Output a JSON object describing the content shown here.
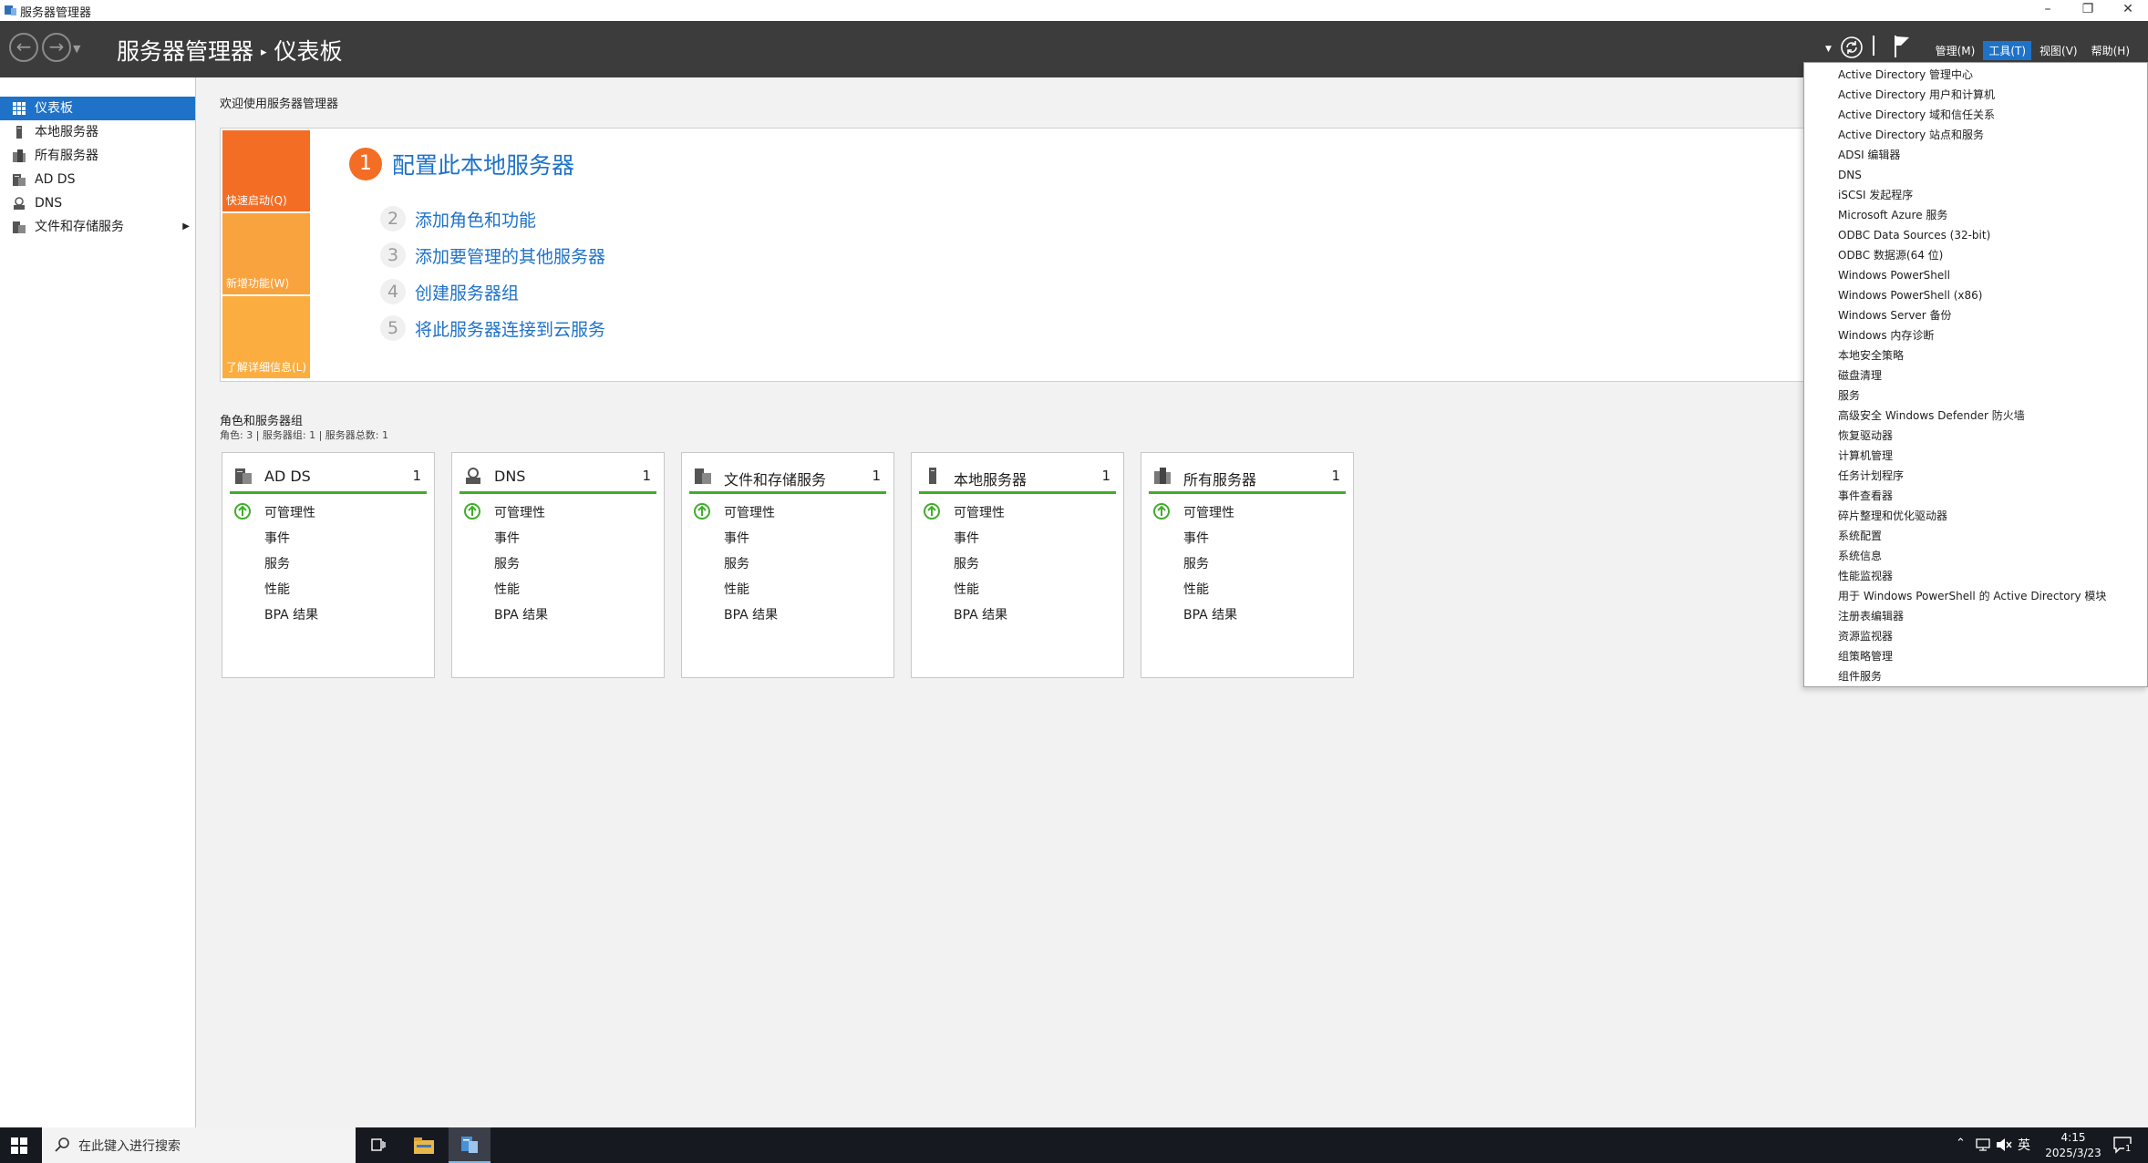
{
  "window": {
    "title": "服务器管理器",
    "controls": [
      "minimize",
      "restore",
      "close"
    ]
  },
  "header": {
    "breadcrumb_root": "服务器管理器",
    "breadcrumb_separator": "▸",
    "breadcrumb_page": "仪表板",
    "menus": {
      "manage": "管理(M)",
      "tools": "工具(T)",
      "view": "视图(V)",
      "help": "帮助(H)"
    },
    "active_menu": "tools"
  },
  "sidebar": {
    "items": [
      {
        "label": "仪表板",
        "icon": "dashboard-icon",
        "selected": true
      },
      {
        "label": "本地服务器",
        "icon": "local-server-icon"
      },
      {
        "label": "所有服务器",
        "icon": "all-servers-icon"
      },
      {
        "label": "AD DS",
        "icon": "ad-ds-icon"
      },
      {
        "label": "DNS",
        "icon": "dns-icon"
      },
      {
        "label": "文件和存储服务",
        "icon": "file-storage-icon",
        "has_submenu": true
      }
    ]
  },
  "welcome": {
    "heading": "欢迎使用服务器管理器",
    "tiles": [
      "快速启动(Q)",
      "新增功能(W)",
      "了解详细信息(L)"
    ],
    "steps": [
      {
        "num": "1",
        "label": "配置此本地服务器"
      },
      {
        "num": "2",
        "label": "添加角色和功能"
      },
      {
        "num": "3",
        "label": "添加要管理的其他服务器"
      },
      {
        "num": "4",
        "label": "创建服务器组"
      },
      {
        "num": "5",
        "label": "将此服务器连接到云服务"
      }
    ]
  },
  "roles": {
    "heading": "角色和服务器组",
    "summary": "角色: 3 | 服务器组: 1 | 服务器总数: 1",
    "cards": [
      {
        "title": "AD DS",
        "count": "1",
        "rows": [
          "可管理性",
          "事件",
          "服务",
          "性能",
          "BPA 结果"
        ]
      },
      {
        "title": "DNS",
        "count": "1",
        "rows": [
          "可管理性",
          "事件",
          "服务",
          "性能",
          "BPA 结果"
        ]
      },
      {
        "title": "文件和存储服务",
        "count": "1",
        "rows": [
          "可管理性",
          "事件",
          "服务",
          "性能",
          "BPA 结果"
        ]
      },
      {
        "title": "本地服务器",
        "count": "1",
        "rows": [
          "可管理性",
          "事件",
          "服务",
          "性能",
          "BPA 结果"
        ]
      },
      {
        "title": "所有服务器",
        "count": "1",
        "rows": [
          "可管理性",
          "事件",
          "服务",
          "性能",
          "BPA 结果"
        ]
      }
    ]
  },
  "tools_menu": [
    "Active Directory 管理中心",
    "Active Directory 用户和计算机",
    "Active Directory 域和信任关系",
    "Active Directory 站点和服务",
    "ADSI 编辑器",
    "DNS",
    "iSCSI 发起程序",
    "Microsoft Azure 服务",
    "ODBC Data Sources (32-bit)",
    "ODBC 数据源(64 位)",
    "Windows PowerShell",
    "Windows PowerShell (x86)",
    "Windows Server 备份",
    "Windows 内存诊断",
    "本地安全策略",
    "磁盘清理",
    "服务",
    "高级安全 Windows Defender 防火墙",
    "恢复驱动器",
    "计算机管理",
    "任务计划程序",
    "事件查看器",
    "碎片整理和优化驱动器",
    "系统配置",
    "系统信息",
    "性能监视器",
    "用于 Windows PowerShell 的 Active Directory 模块",
    "注册表编辑器",
    "资源监视器",
    "组策略管理",
    "组件服务"
  ],
  "taskbar": {
    "search_placeholder": "在此键入进行搜索",
    "ime": "英",
    "time": "4:15",
    "date": "2025/3/23",
    "notification_count": "1"
  },
  "colors": {
    "header_bg": "#3c3c3c",
    "accent": "#1e72c8",
    "quick_start_tile": "#f36d24",
    "whats_new_tile": "#f9a33f",
    "learn_more_tile": "#fbad3f",
    "status_ok": "#3fae2a"
  }
}
